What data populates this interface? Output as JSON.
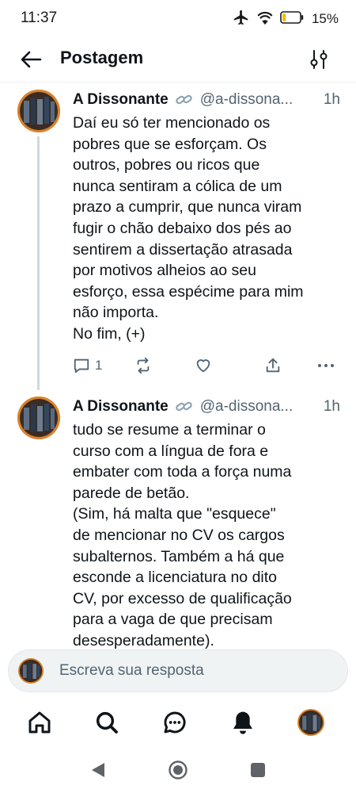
{
  "status_bar": {
    "time": "11:37",
    "battery_percent": "15%",
    "icons": [
      "airplane-icon",
      "wifi-icon",
      "battery-icon"
    ]
  },
  "header": {
    "title": "Postagem",
    "back_icon": "back-arrow-icon",
    "filter_icon": "filter-sliders-icon"
  },
  "posts": [
    {
      "author": "A Dissonante",
      "handle": "@a-dissona...",
      "time": "1h",
      "text": "Daí eu só ter mencionado os\npobres que se esforçam. Os\noutros, pobres ou ricos que\nnunca sentiram a cólica de um\nprazo a cumprir, que nunca viram\nfugir o chão debaixo dos pés ao\nsentirem a dissertação atrasada\npor motivos alheios ao seu\nesforço, essa espécime para mim\nnão importa.\nNo fim, (+)",
      "reply_count": "1"
    },
    {
      "author": "A Dissonante",
      "handle": "@a-dissona...",
      "time": "1h",
      "text": "tudo se resume a terminar o\ncurso com a língua de fora e\nembater com toda a força numa\nparede de betão.\n(Sim, há malta que \"esquece\"\nde mencionar no CV os cargos\nsubalternos. Também a há que\nesconde a licenciatura no dito\nCV, por excesso de qualificação\npara a vaga de que precisam\ndesesperadamente)."
    }
  ],
  "reply_bar": {
    "placeholder": "Escreva sua resposta"
  },
  "bottom_nav": [
    "home-icon",
    "search-icon",
    "chat-icon",
    "notifications-bell-icon",
    "profile-avatar"
  ],
  "system_nav": [
    "back-triangle-icon",
    "home-circle-icon",
    "recents-square-icon"
  ],
  "colors": {
    "text": "#0f1419",
    "secondary_text": "#536471",
    "accent": "#1d9bf0",
    "divider": "#eff3f4",
    "thread_line": "#cfd9de"
  }
}
